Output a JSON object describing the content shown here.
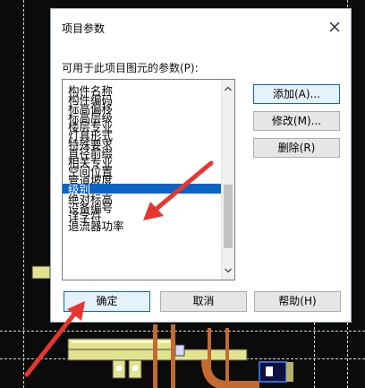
{
  "dialog": {
    "title": "项目参数",
    "close_icon": "close-icon",
    "param_label": "可用于此项目图元的参数(P):",
    "list_items": [
      "构件名称",
      "构件编码",
      "标高偏移",
      "标高层级",
      "楼层专业",
      "灯具形式",
      "特殊要求",
      "直径前缀",
      "相关专业",
      "空间位置",
      "管道坡度",
      "级别",
      "绝对标高",
      "设备编号",
      "详字符",
      "退流器功率"
    ],
    "selected_item": "级别",
    "buttons": {
      "add": "添加(A)...",
      "edit": "修改(M)...",
      "delete": "删除(R)",
      "ok": "确定",
      "cancel": "取消",
      "help": "帮助(H)"
    }
  },
  "colors": {
    "selection": "#0a64c8",
    "annotation_arrow": "#e8362f",
    "cad_background": "#0b0b0b",
    "cad_pipe": "#e2e28f"
  }
}
